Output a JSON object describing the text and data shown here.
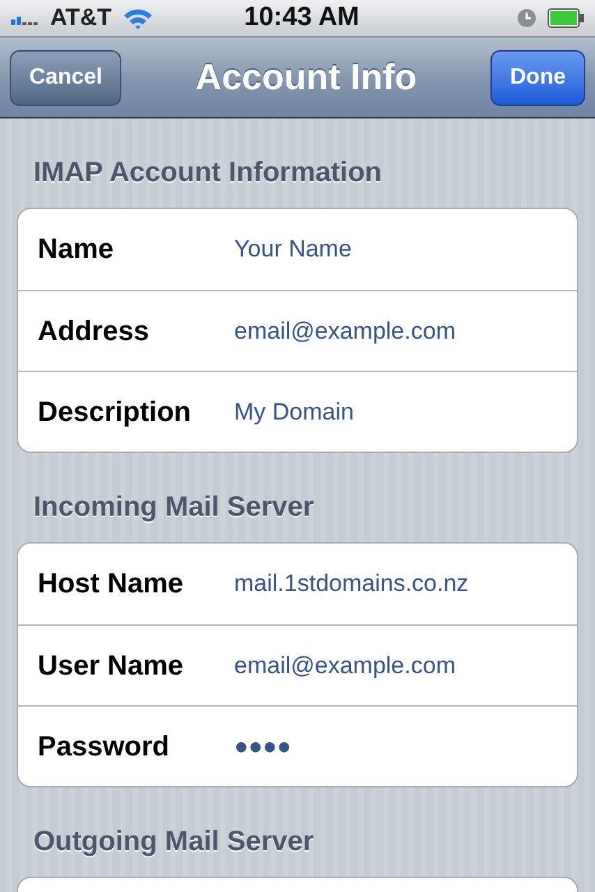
{
  "status_bar": {
    "carrier": "AT&T",
    "time": "10:43 AM"
  },
  "nav_bar": {
    "title": "Account Info",
    "left_button": "Cancel",
    "right_button": "Done"
  },
  "sections": [
    {
      "title": "IMAP Account Information",
      "rows": [
        {
          "label": "Name",
          "value": "Your Name"
        },
        {
          "label": "Address",
          "value": "email@example.com"
        },
        {
          "label": "Description",
          "value": "My Domain"
        }
      ]
    },
    {
      "title": "Incoming Mail Server",
      "rows": [
        {
          "label": "Host Name",
          "value": "mail.1stdomains.co.nz"
        },
        {
          "label": "User Name",
          "value": "email@example.com"
        },
        {
          "label": "Password",
          "value": "●●●●"
        }
      ]
    },
    {
      "title": "Outgoing Mail Server"
    }
  ]
}
